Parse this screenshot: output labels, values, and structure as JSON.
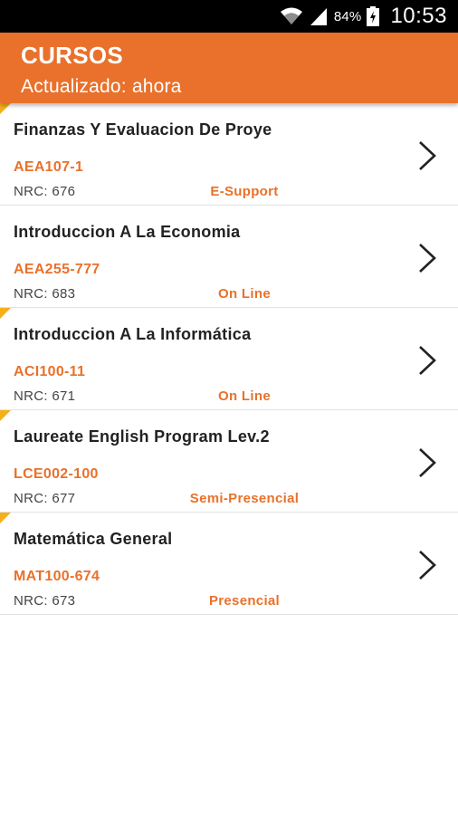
{
  "status_bar": {
    "battery_percent": "84%",
    "time": "10:53",
    "icons": [
      "wifi-icon",
      "signal-icon",
      "battery-icon"
    ]
  },
  "header": {
    "title": "CURSOS",
    "subtitle": "Actualizado: ahora"
  },
  "colors": {
    "accent": "#e9712b",
    "corner_marker": "#f5b019",
    "status_bar": "#000000"
  },
  "courses": [
    {
      "name": "Finanzas Y Evaluacion De Proye",
      "code": "AEA107-1",
      "nrc": "NRC: 676",
      "modality": "E-Support"
    },
    {
      "name": "Introduccion A La Economia",
      "code": "AEA255-777",
      "nrc": "NRC: 683",
      "modality": "On Line"
    },
    {
      "name": "Introduccion A La Informática",
      "code": "ACI100-11",
      "nrc": "NRC: 671",
      "modality": "On Line"
    },
    {
      "name": "Laureate English Program Lev.2",
      "code": "LCE002-100",
      "nrc": "NRC: 677",
      "modality": "Semi-Presencial"
    },
    {
      "name": "Matemática General",
      "code": "MAT100-674",
      "nrc": "NRC: 673",
      "modality": "Presencial"
    }
  ]
}
